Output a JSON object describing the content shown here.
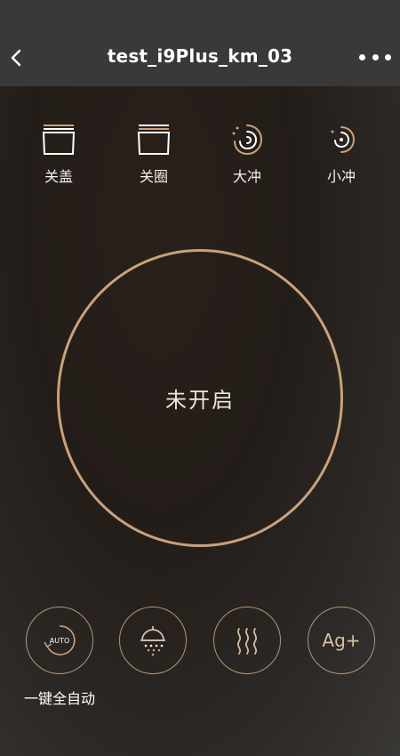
{
  "header": {
    "title": "test_i9Plus_km_03",
    "back_icon": "chevron-left-icon",
    "more_icon": "more-dots-icon"
  },
  "functions": [
    {
      "label": "关盖",
      "icon": "lid-icon"
    },
    {
      "label": "关圈",
      "icon": "seat-icon"
    },
    {
      "label": "大冲",
      "icon": "swirl-large-icon"
    },
    {
      "label": "小冲",
      "icon": "swirl-small-icon"
    }
  ],
  "status": {
    "text": "未开启"
  },
  "bottom_buttons": [
    {
      "label": "一键全自动",
      "icon": "auto-icon",
      "icon_text": "AUTO"
    },
    {
      "label": "",
      "icon": "shower-icon"
    },
    {
      "label": "",
      "icon": "heat-waves-icon"
    },
    {
      "label": "",
      "icon": "silver-ion-icon",
      "icon_text": "Ag+"
    }
  ],
  "colors": {
    "header_bg": "#393939",
    "accent": "#c9a27a",
    "text": "#ffffff"
  }
}
